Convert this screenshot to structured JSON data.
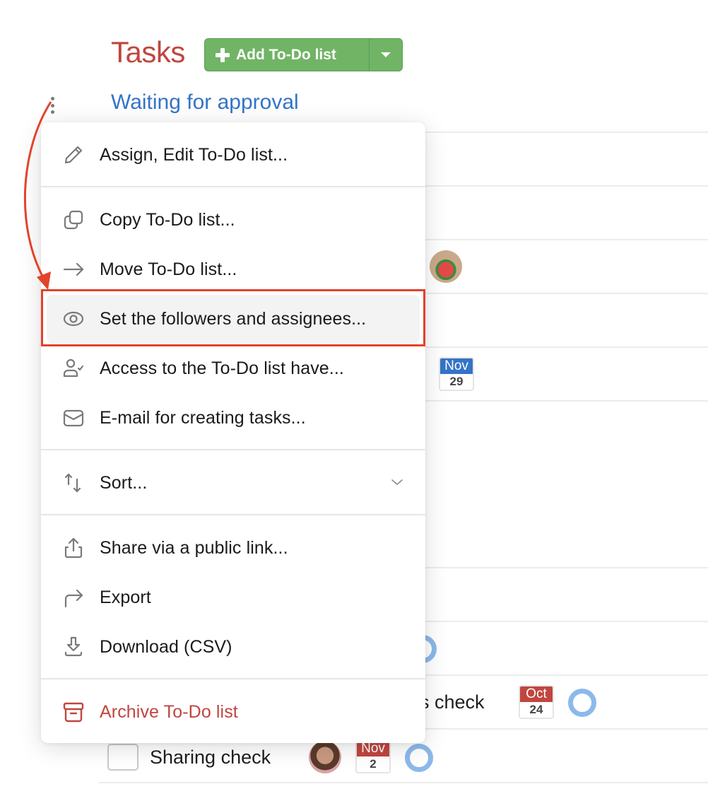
{
  "header": {
    "title": "Tasks",
    "add_button_label": "Add To-Do list",
    "add_button_icon": "plus-icon",
    "add_button_dropdown_icon": "caret-down-icon"
  },
  "todo_list": {
    "title": "Waiting for approval",
    "more_icon": "vertical-ellipsis-icon"
  },
  "context_menu": {
    "groups": [
      [
        {
          "label": "Assign, Edit To-Do list...",
          "icon": "pencil-icon"
        }
      ],
      [
        {
          "label": "Copy To-Do list...",
          "icon": "copy-icon"
        },
        {
          "label": "Move To-Do list...",
          "icon": "arrow-right-icon"
        },
        {
          "label": "Set the followers and assignees...",
          "icon": "eye-icon",
          "highlighted": true
        },
        {
          "label": "Access to the To-Do list have...",
          "icon": "user-check-icon"
        },
        {
          "label": "E-mail for creating tasks...",
          "icon": "envelope-icon"
        }
      ],
      [
        {
          "label": "Sort...",
          "icon": "sort-icon",
          "expand_icon": "chevron-down-icon"
        }
      ],
      [
        {
          "label": "Share via a public link...",
          "icon": "share-icon"
        },
        {
          "label": "Export",
          "icon": "export-arrow-icon"
        },
        {
          "label": "Download (CSV)",
          "icon": "download-icon"
        }
      ],
      [
        {
          "label": "Archive To-Do list",
          "icon": "archive-icon",
          "danger": true
        }
      ]
    ]
  },
  "background_tasks": [
    {
      "title_fragment": "",
      "date": {
        "month": "Nov",
        "day": "29",
        "color": "#3474c6"
      }
    },
    {
      "title_fragment": "s check",
      "date": {
        "month": "Oct",
        "day": "24",
        "color": "#c0463f"
      }
    },
    {
      "title": "Sharing check",
      "date": {
        "month": "Nov",
        "day": "2",
        "color": "#c0463f"
      }
    }
  ],
  "colors": {
    "title_red": "#c0463f",
    "list_blue": "#3474c6",
    "button_green": "#71b466",
    "annotation_red": "#e2432a",
    "ring_blue": "#8bb9eb"
  }
}
